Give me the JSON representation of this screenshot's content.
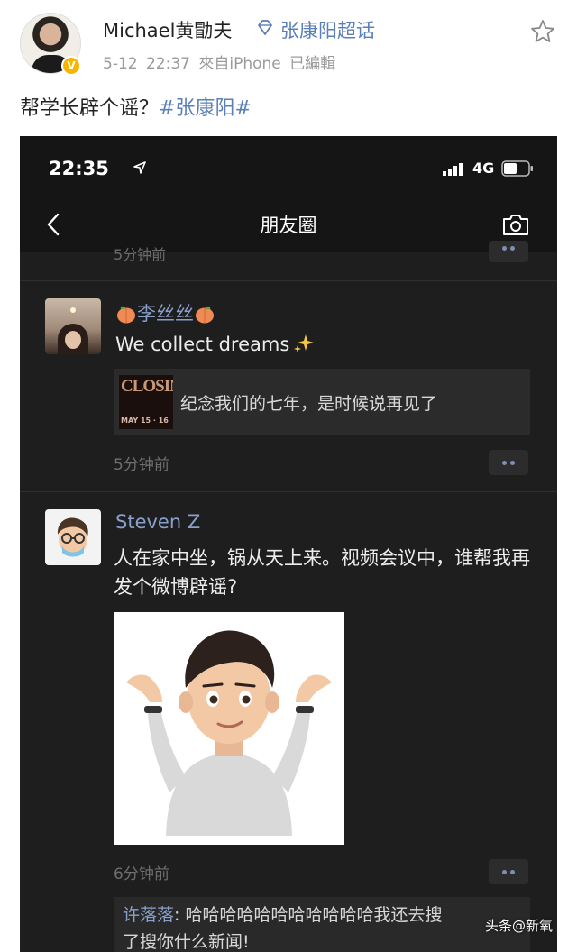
{
  "post": {
    "username": "Michael黄勖夫",
    "topic": "张康阳超话",
    "meta": "5-12 22:37 來自iPhone 已編輯",
    "text": "帮学长辟个谣？",
    "hashtag": "#张康阳#"
  },
  "phone": {
    "time": "22:35",
    "network": "4G",
    "nav_title": "朋友圈",
    "faded_time": "5分钟前",
    "moments": [
      {
        "name": "李丝丝",
        "text": "We collect dreams",
        "link_thumb_title": "CLOSIN",
        "link_thumb_sub": "MAY 15 · 16",
        "link_text": "纪念我们的七年，是时候说再见了",
        "time": "5分钟前"
      },
      {
        "name": "Steven Z",
        "text": "人在家中坐，锅从天上来。视频会议中，谁帮我再发个微博辟谣?",
        "time": "6分钟前",
        "comment_author": "许落落",
        "comment_text_1": ": 哈哈哈哈哈哈哈哈哈哈哈我还去搜",
        "comment_text_2": "了搜你什么新闻!"
      }
    ]
  },
  "watermark": "头条@新氧",
  "colors": {
    "link_blue": "#5b7fb8",
    "wechat_name": "#8aa0cc",
    "dark_bg": "#1e1e1e",
    "verified_gold": "#f7b500"
  }
}
